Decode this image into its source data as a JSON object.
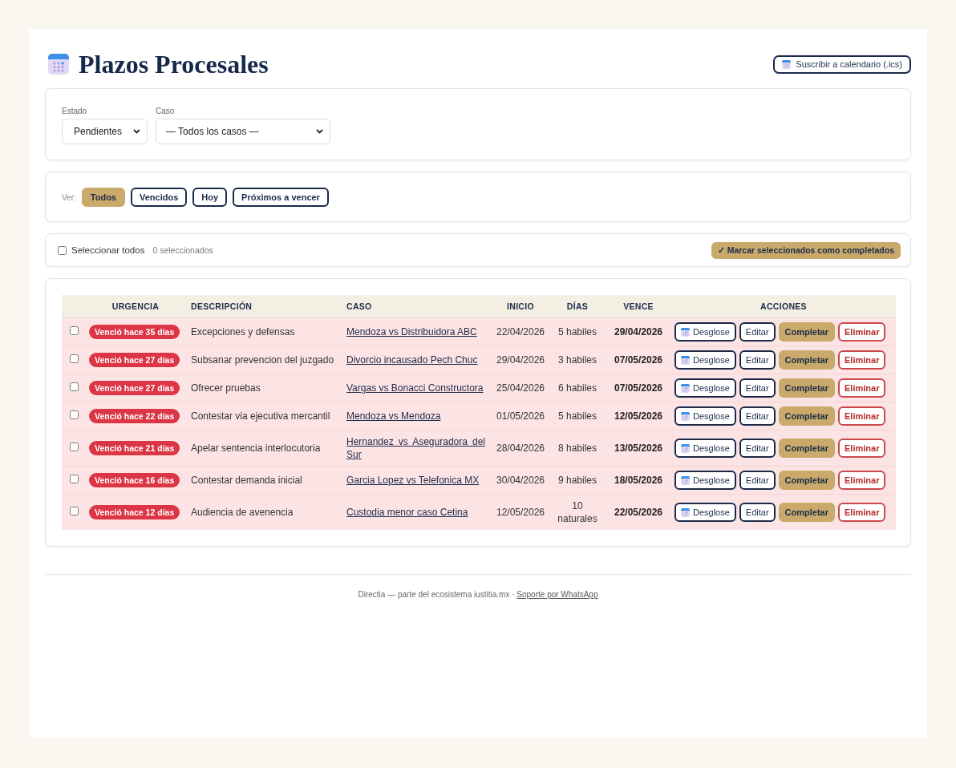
{
  "header": {
    "title": "Plazos Procesales",
    "subscribe_button": "Suscribir a calendario (.ics)"
  },
  "filters": [
    {
      "label": "Estado",
      "value": "Pendientes"
    },
    {
      "label": "Caso",
      "value": "— Todos los casos —"
    }
  ],
  "quick_filter": {
    "label": "Ver:",
    "chips": [
      {
        "label": "Todos",
        "selected": true
      },
      {
        "label": "Vencidos",
        "selected": false
      },
      {
        "label": "Hoy",
        "selected": false
      },
      {
        "label": "Próximos a vencer",
        "selected": false
      }
    ]
  },
  "selection_bar": {
    "select_all_label": "Seleccionar todos",
    "checked": false,
    "count": "0 seleccionados",
    "bulk_button": "✓ Marcar seleccionados como completados"
  },
  "table": {
    "columns": [
      "URGENCIA",
      "DESCRIPCIÓN",
      "CASO",
      "INICIO",
      "DÍAS",
      "VENCE",
      "ACCIONES"
    ],
    "rows": [
      {
        "checked": false,
        "urgency": "Venció hace 35 días",
        "description": "Excepciones y defensas",
        "case": "Mendoza vs Distribuidora ABC",
        "start": "22/04/2026",
        "days": "5 habiles",
        "due": "29/04/2026",
        "actions": [
          {
            "kind": "breakdown",
            "label": "Desglose"
          },
          {
            "kind": "edit",
            "label": "Editar"
          },
          {
            "kind": "complete",
            "label": "Completar"
          },
          {
            "kind": "delete",
            "label": "Eliminar"
          }
        ]
      },
      {
        "checked": false,
        "urgency": "Venció hace 27 días",
        "description": "Subsanar prevencion del juzgado",
        "case": "Divorcio incausado Pech Chuc",
        "start": "29/04/2026",
        "days": "3 habiles",
        "due": "07/05/2026",
        "actions": [
          {
            "kind": "breakdown",
            "label": "Desglose"
          },
          {
            "kind": "edit",
            "label": "Editar"
          },
          {
            "kind": "complete",
            "label": "Completar"
          },
          {
            "kind": "delete",
            "label": "Eliminar"
          }
        ]
      },
      {
        "checked": false,
        "urgency": "Venció hace 27 días",
        "description": "Ofrecer pruebas",
        "case": "Vargas vs Bonacci Constructora",
        "start": "25/04/2026",
        "days": "6 habiles",
        "due": "07/05/2026",
        "actions": [
          {
            "kind": "breakdown",
            "label": "Desglose"
          },
          {
            "kind": "edit",
            "label": "Editar"
          },
          {
            "kind": "complete",
            "label": "Completar"
          },
          {
            "kind": "delete",
            "label": "Eliminar"
          }
        ]
      },
      {
        "checked": false,
        "urgency": "Venció hace 22 días",
        "description": "Contestar via ejecutiva mercantil",
        "case": "Mendoza vs Mendoza",
        "start": "01/05/2026",
        "days": "5 habiles",
        "due": "12/05/2026",
        "actions": [
          {
            "kind": "breakdown",
            "label": "Desglose"
          },
          {
            "kind": "edit",
            "label": "Editar"
          },
          {
            "kind": "complete",
            "label": "Completar"
          },
          {
            "kind": "delete",
            "label": "Eliminar"
          }
        ]
      },
      {
        "checked": false,
        "urgency": "Venció hace 21 días",
        "description": "Apelar sentencia interlocutoria",
        "case": "Hernandez vs Aseguradora del Sur",
        "start": "28/04/2026",
        "days": "8 habiles",
        "due": "13/05/2026",
        "actions": [
          {
            "kind": "breakdown",
            "label": "Desglose"
          },
          {
            "kind": "edit",
            "label": "Editar"
          },
          {
            "kind": "complete",
            "label": "Completar"
          },
          {
            "kind": "delete",
            "label": "Eliminar"
          }
        ]
      },
      {
        "checked": false,
        "urgency": "Venció hace 16 días",
        "description": "Contestar demanda inicial",
        "case": "Garcia Lopez vs Telefonica MX",
        "start": "30/04/2026",
        "days": "9 habiles",
        "due": "18/05/2026",
        "actions": [
          {
            "kind": "breakdown",
            "label": "Desglose"
          },
          {
            "kind": "edit",
            "label": "Editar"
          },
          {
            "kind": "complete",
            "label": "Completar"
          },
          {
            "kind": "delete",
            "label": "Eliminar"
          }
        ]
      },
      {
        "checked": false,
        "urgency": "Venció hace 12 días",
        "description": "Audiencia de avenencia",
        "case": "Custodia menor caso Cetina",
        "start": "12/05/2026",
        "days": "10 naturales",
        "due": "22/05/2026",
        "actions": [
          {
            "kind": "breakdown",
            "label": "Desglose"
          },
          {
            "kind": "edit",
            "label": "Editar"
          },
          {
            "kind": "complete",
            "label": "Completar"
          },
          {
            "kind": "delete",
            "label": "Eliminar"
          }
        ]
      }
    ]
  },
  "footer": {
    "text": "Directia — parte del ecosistema iustitia.mx ·",
    "link": "Soporte por WhatsApp"
  }
}
